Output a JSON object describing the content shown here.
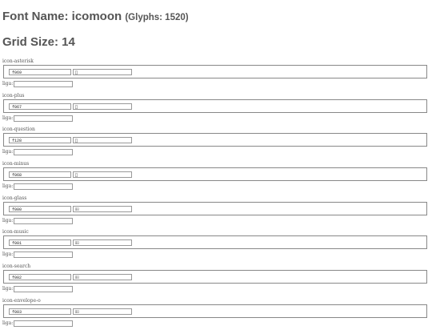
{
  "header": {
    "font_label": "Font Name: icomoon",
    "glyph_count": "(Glyphs: 1520)",
    "grid_label": "Grid Size: 14"
  },
  "liga_label": "liga:",
  "glyphs": [
    {
      "name": "icon-asterisk",
      "code": "f069",
      "char": ""
    },
    {
      "name": "icon-plus",
      "code": "f067",
      "char": ""
    },
    {
      "name": "icon-question",
      "code": "f128",
      "char": ""
    },
    {
      "name": "icon-minus",
      "code": "f068",
      "char": ""
    },
    {
      "name": "icon-glass",
      "code": "f000",
      "char": ""
    },
    {
      "name": "icon-music",
      "code": "f001",
      "char": ""
    },
    {
      "name": "icon-search",
      "code": "f002",
      "char": ""
    },
    {
      "name": "icon-envelope-o",
      "code": "f003",
      "char": ""
    }
  ]
}
